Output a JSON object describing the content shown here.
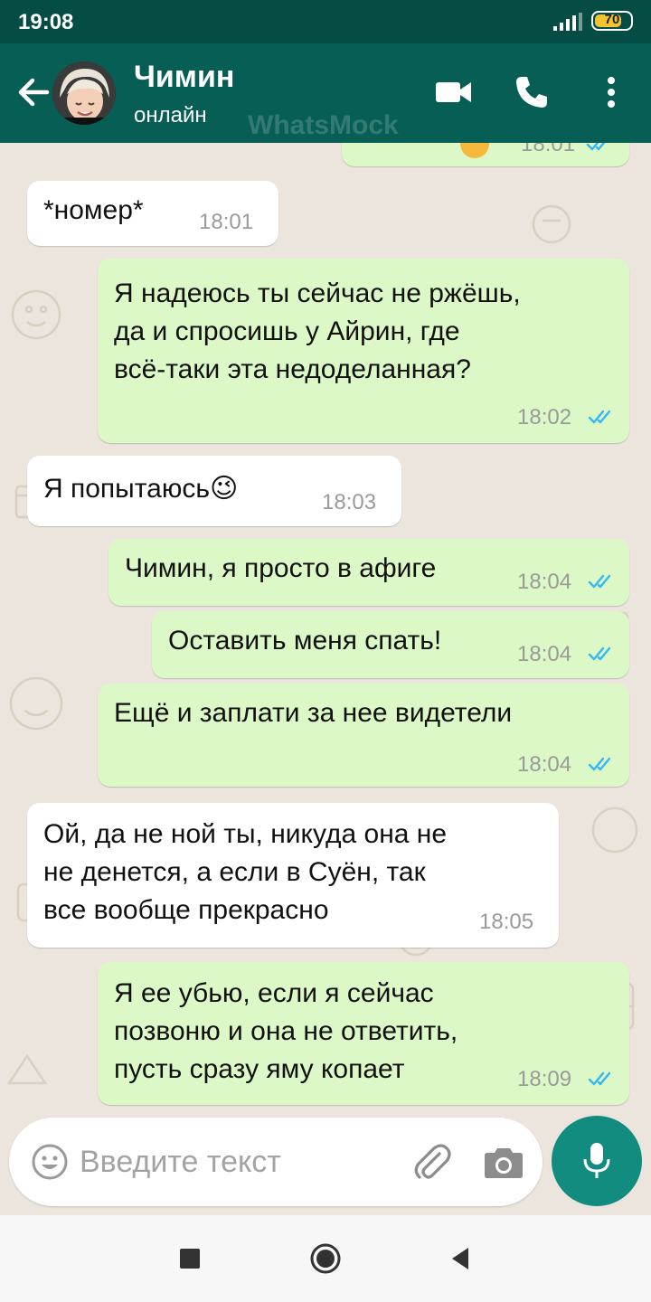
{
  "status_bar": {
    "time": "19:08",
    "battery": "70",
    "battery_level": 0.7
  },
  "header": {
    "contact_name": "Чимин",
    "contact_status": "онлайн",
    "watermark": "WhatsMock",
    "icons": [
      "back-arrow-icon",
      "video-call-icon",
      "phone-icon",
      "more-vert-icon"
    ]
  },
  "messages": [
    {
      "direction": "out",
      "text": "",
      "time": "18:01",
      "read": true,
      "partial": true
    },
    {
      "direction": "in",
      "text": "*номер*",
      "time": "18:01"
    },
    {
      "direction": "out",
      "text": "Я надеюсь ты сейчас не ржёшь,\nда и спросишь у Айрин, где\nвсё-таки эта недоделанная?",
      "time": "18:02",
      "read": true
    },
    {
      "direction": "in",
      "text": "Я попытаюсь😉",
      "time": "18:03"
    },
    {
      "direction": "out",
      "text": "Чимин, я просто в афиге",
      "time": "18:04",
      "read": true
    },
    {
      "direction": "out",
      "text": "Оставить меня спать!",
      "time": "18:04",
      "read": true
    },
    {
      "direction": "out",
      "text": "Ещё и заплати за нее видетели",
      "time": "18:04",
      "read": true
    },
    {
      "direction": "in",
      "text": "Ой, да не ной ты, никуда она не\nне денется, а если в Суён, так\nвсе вообще прекрасно",
      "time": "18:05"
    },
    {
      "direction": "out",
      "text": "Я ее убью, если я сейчас\nпозвоню и она не ответить,\nпусть сразу яму копает",
      "time": "18:09",
      "read": true
    }
  ],
  "composer": {
    "placeholder": "Введите текст",
    "icons": [
      "emoji-icon",
      "paperclip-icon",
      "camera-icon",
      "microphone-icon"
    ]
  },
  "nav_bar": {
    "icons": [
      "recents-square-icon",
      "home-circle-icon",
      "back-triangle-icon"
    ]
  },
  "colors": {
    "header": "#075e54",
    "status_bar": "#054d44",
    "chat_background": "#ece5dd",
    "outgoing_bubble": "#dcf8c6",
    "incoming_bubble": "#ffffff",
    "read_ticks": "#34b7f1",
    "mic_button": "#128c7e",
    "battery_fill": "#f4c430"
  }
}
